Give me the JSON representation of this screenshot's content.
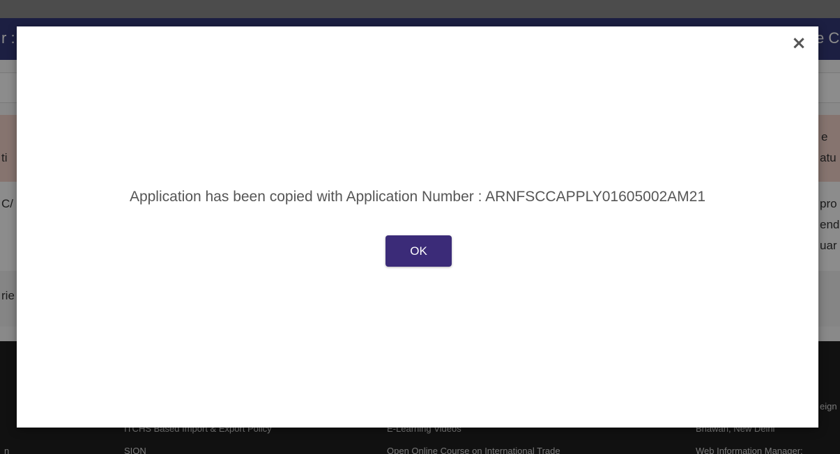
{
  "colors": {
    "header_bg": "#343a78",
    "table_head_bg": "#f4d3cb",
    "footer_bg": "#1f1f1f",
    "ok_button_bg": "#3b2b78",
    "message_text": "#555555"
  },
  "background": {
    "header_left_fragment": "r :",
    "header_right_fragment": "e C",
    "table_head_left_fragment": "ti",
    "table_head_right_line1": "e",
    "table_head_right_line2": "atu",
    "row1_left_fragment": "C/",
    "row1_right_line1": "pro",
    "row1_right_line2": "end",
    "row1_right_line3": "uar",
    "row2_left_fragment": "rie",
    "footer_right_fragment": "eign",
    "footer_links": {
      "col1_item1": "ITCHS Based Import & Export Policy",
      "col1_item2": "SION",
      "col2_item1": "E-Learning Videos",
      "col2_item2": "Open Online Course on International Trade",
      "col3_item1": "Bhawan, New Delhi",
      "col3_item2": "Web Information Manager:",
      "left_fragment": "n"
    }
  },
  "modal": {
    "close_icon": "×",
    "message": "Application has been copied with Application Number : ARNFSCCAPPLY01605002AM21",
    "ok_label": "OK"
  }
}
